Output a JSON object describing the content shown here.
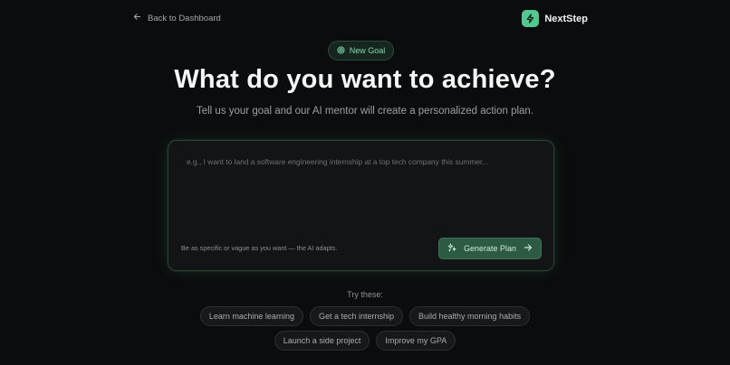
{
  "nav": {
    "back_label": "Back to Dashboard",
    "back_icon": "arrow-left-icon"
  },
  "brand": {
    "name": "NextStep",
    "logo_icon": "lightning-icon",
    "accent": "#4fc98f"
  },
  "hero": {
    "badge_label": "New Goal",
    "badge_icon": "target-icon",
    "title": "What do you want to achieve?",
    "subtitle": "Tell us your goal and our AI mentor will create a personalized action plan."
  },
  "goal_form": {
    "placeholder": "e.g., I want to land a software engineering internship at a top tech company this summer...",
    "value": "",
    "hint": "Be as specific or vague as you want — the AI adapts.",
    "generate_label": "Generate Plan",
    "generate_icon": "sparkles-icon",
    "generate_trailing_icon": "arrow-right-icon"
  },
  "suggestions": {
    "label": "Try these:",
    "row1": [
      "Learn machine learning",
      "Get a tech internship",
      "Build healthy morning habits"
    ],
    "row2": [
      "Launch a side project",
      "Improve my GPA"
    ]
  }
}
